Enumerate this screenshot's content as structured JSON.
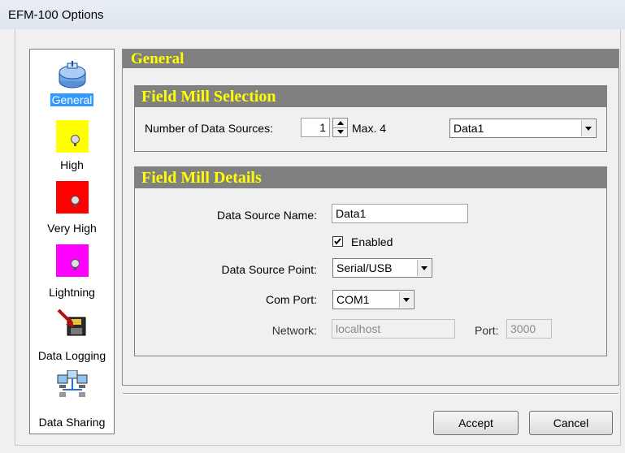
{
  "window": {
    "title": "EFM-100 Options"
  },
  "sidebar": {
    "items": [
      {
        "label": "General",
        "icon": "field-mill-icon",
        "selected": true
      },
      {
        "label": "High",
        "icon": "high-alarm-icon",
        "color": "#ffff00"
      },
      {
        "label": "Very High",
        "icon": "very-high-alarm-icon",
        "color": "#ff0000"
      },
      {
        "label": "Lightning",
        "icon": "lightning-alarm-icon",
        "color": "#ff00ff"
      },
      {
        "label": "Data Logging",
        "icon": "data-logging-icon"
      },
      {
        "label": "Data Sharing",
        "icon": "data-sharing-icon"
      }
    ]
  },
  "main": {
    "header": "General",
    "selection": {
      "title": "Field Mill Selection",
      "num_sources_label": "Number of Data Sources:",
      "num_sources_value": "1",
      "max_label": "Max. 4",
      "source_select_value": "Data1"
    },
    "details": {
      "title": "Field Mill Details",
      "name_label": "Data Source Name:",
      "name_value": "Data1",
      "enabled_label": "Enabled",
      "enabled_checked": true,
      "point_label": "Data Source Point:",
      "point_value": "Serial/USB",
      "com_label": "Com Port:",
      "com_value": "COM1",
      "network_label": "Network:",
      "network_value": "localhost",
      "port_label": "Port:",
      "port_value": "3000"
    }
  },
  "footer": {
    "accept_label": "Accept",
    "cancel_label": "Cancel"
  },
  "colors": {
    "header_bg": "#808080",
    "header_text": "#ffff00",
    "selection": "#3399ff"
  }
}
